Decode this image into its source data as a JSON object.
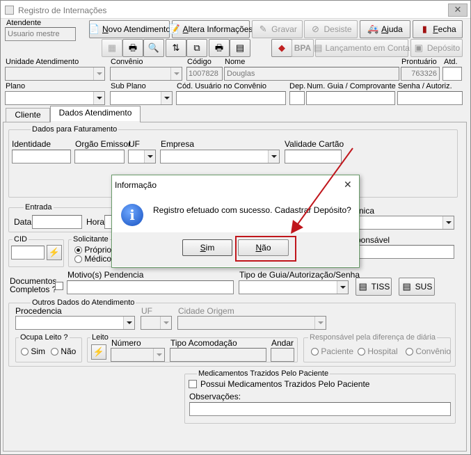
{
  "window": {
    "title": "Registro de Internações"
  },
  "header": {
    "atendente_label": "Atendente",
    "atendente_value": "Usuario mestre",
    "unidade_label": "Unidade Atendimento",
    "convenio_label": "Convênio",
    "codigo_label": "Código",
    "codigo_value": "1007828",
    "nome_label": "Nome",
    "nome_value": "Douglas",
    "prontuario_label": "Prontuário",
    "prontuario_value": "763326",
    "atd_label": "Atd.",
    "plano_label": "Plano",
    "subplano_label": "Sub Plano",
    "cod_usuario_label": "Cód. Usuário no Convênio",
    "dep_label": "Dep.",
    "guia_label": "Num. Guia / Comprovante",
    "senha_label": "Senha / Autoriz."
  },
  "toolbar": {
    "novo": "Novo Atendimento",
    "novo_u": "N",
    "novo_rest": "ovo Atendimento",
    "altera": "Altera Informações",
    "altera_u": "A",
    "altera_rest": "ltera Informações",
    "gravar": "Gravar",
    "desiste": "Desiste",
    "ajuda": "Ajuda",
    "ajuda_u": "A",
    "ajuda_rest": "juda",
    "fecha": "Fecha",
    "fecha_u": "F",
    "fecha_rest": "echa",
    "bpa": "BPA",
    "lancamento": "Lançamento em Conta",
    "deposito": "Depósito"
  },
  "tabs": [
    {
      "label": "Cliente"
    },
    {
      "label": "Dados Atendimento"
    }
  ],
  "faturamento": {
    "legend": "Dados para Faturamento",
    "identidade": "Identidade",
    "orgao": "Orgão Emissor",
    "uf": "UF",
    "empresa": "Empresa",
    "validade": "Validade Cartão"
  },
  "entrada": {
    "legend": "Entrada",
    "data": "Data",
    "hora": "Hora",
    "clinica_partial": "nica"
  },
  "cid": {
    "legend": "CID"
  },
  "solicitante": {
    "legend": "Solicitante",
    "opt1": "Próprio C",
    "opt2": "Médico"
  },
  "responsavel_partial": "ponsável",
  "documentos": {
    "label1": "Documentos",
    "label2": "Completos ?"
  },
  "motivo": {
    "label": "Motivo(s) Pendencia"
  },
  "tipo_guia": {
    "label": "Tipo de Guia/Autorização/Senha",
    "tiss": "TISS",
    "sus": "SUS"
  },
  "outros": {
    "legend": "Outros Dados do Atendimento",
    "procedencia": "Procedencia",
    "uf": "UF",
    "cidade": "Cidade Origem"
  },
  "ocupa": {
    "legend": "Ocupa Leito ?",
    "sim": "Sim",
    "nao": "Não"
  },
  "leito": {
    "legend": "Leito",
    "numero": "Número",
    "tipo": "Tipo Acomodação",
    "andar": "Andar"
  },
  "resp_diaria": {
    "legend": "Responsável pela diferença de diária",
    "paciente": "Paciente",
    "hospital": "Hospital",
    "convenio": "Convênio"
  },
  "medicamentos": {
    "legend": "Medicamentos Trazidos Pelo Paciente",
    "check": "Possui Medicamentos Trazidos Pelo Paciente",
    "obs": "Observações:"
  },
  "dialog": {
    "title": "Informação",
    "message": "Registro efetuado com sucesso. Cadastrar Depósito?",
    "sim": "Sim",
    "sim_u": "S",
    "sim_rest": "im",
    "nao": "Não",
    "nao_u": "N",
    "nao_rest": "ão"
  },
  "colors": {
    "highlight": "#c0161c",
    "arrow": "#c0161c",
    "dialog_border": "#6a9b6a"
  }
}
